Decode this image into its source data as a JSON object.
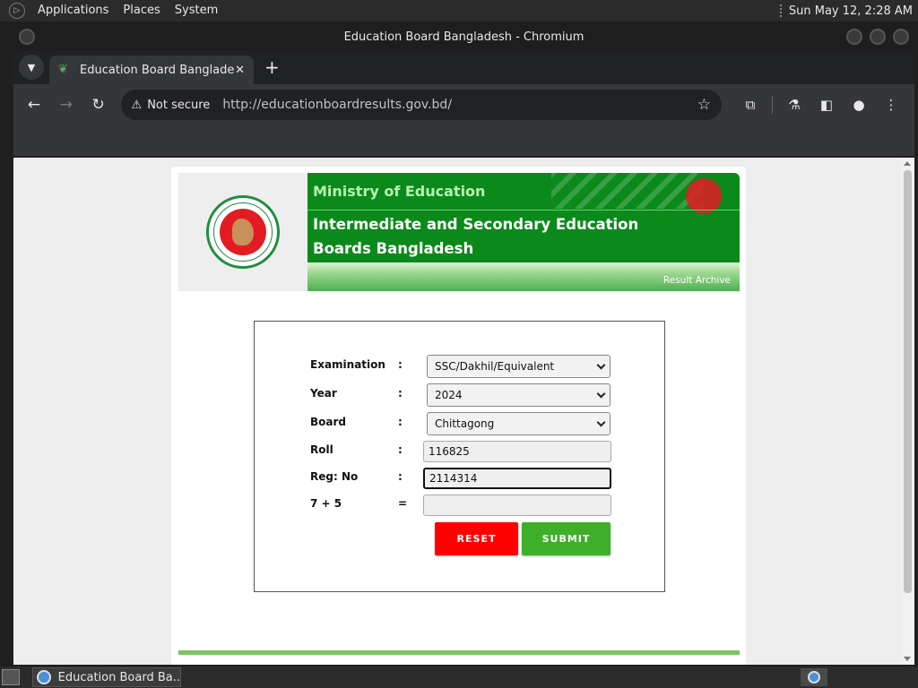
{
  "panel": {
    "applications": "Applications",
    "places": "Places",
    "system": "System",
    "clock": "Sun May 12,  2:28 AM"
  },
  "window": {
    "title": "Education Board Bangladesh - Chromium"
  },
  "tab": {
    "title": "Education Board Bangladesh",
    "close": "✕",
    "new_tab": "+"
  },
  "toolbar": {
    "security": "Not secure",
    "url": "http://educationboardresults.gov.bd/"
  },
  "site": {
    "ministry": "Ministry of Education",
    "boards": "Intermediate and Secondary Education Boards Bangladesh",
    "archive_link": "Result Archive"
  },
  "form": {
    "examination": {
      "label": "Examination",
      "colon": ":",
      "value": "SSC/Dakhil/Equivalent"
    },
    "year": {
      "label": "Year",
      "colon": ":",
      "value": "2024"
    },
    "board": {
      "label": "Board",
      "colon": ":",
      "value": "Chittagong"
    },
    "roll": {
      "label": "Roll",
      "colon": ":",
      "value": "116825"
    },
    "reg": {
      "label": "Reg: No",
      "colon": ":",
      "value": "2114314"
    },
    "captcha": {
      "label": "7 + 5",
      "colon": "=",
      "value": ""
    },
    "reset": "RESET",
    "submit": "SUBMIT"
  },
  "taskbar": {
    "item": "Education Board Ba..."
  },
  "colors": {
    "green_header": "#0b8a1b",
    "reset_red": "#ff0000",
    "submit_green": "#3fae29"
  }
}
